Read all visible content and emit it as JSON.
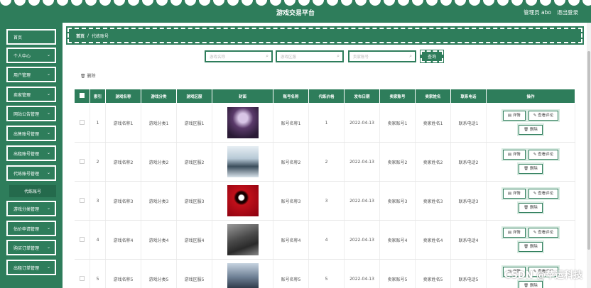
{
  "header": {
    "title": "游戏交易平台",
    "admin_label": "管理员 abo",
    "logout_label": "退出登录"
  },
  "sidebar": {
    "items": [
      {
        "label": "首页",
        "expandable": false
      },
      {
        "label": "个人中心",
        "expandable": true
      },
      {
        "label": "用户管理",
        "expandable": true
      },
      {
        "label": "卖家管理",
        "expandable": true
      },
      {
        "label": "网站公告管理",
        "expandable": true
      },
      {
        "label": "出售账号管理",
        "expandable": true
      },
      {
        "label": "出租账号管理",
        "expandable": true
      },
      {
        "label": "代练账号管理",
        "expandable": true
      },
      {
        "label": "游戏分类管理",
        "expandable": true
      },
      {
        "label": "估价申请管理",
        "expandable": true
      },
      {
        "label": "购买订单管理",
        "expandable": true
      },
      {
        "label": "出租订单管理",
        "expandable": true
      }
    ],
    "sub_item": "代练账号"
  },
  "breadcrumb": {
    "home": "首页",
    "separator": "/",
    "current": "代练账号"
  },
  "search": {
    "game_name_placeholder": "游戏名称",
    "game_region_placeholder": "游戏区服",
    "seller_account_placeholder": "卖家账号",
    "button_label": "查询"
  },
  "toolbar": {
    "delete_label": "删除"
  },
  "table": {
    "headers": [
      "索引",
      "游戏名称",
      "游戏分类",
      "游戏区服",
      "封面",
      "账号名称",
      "代练价格",
      "发布日期",
      "卖家账号",
      "卖家姓名",
      "联系电话",
      "操作"
    ],
    "rows": [
      {
        "index": "1",
        "game_name": "游戏名称1",
        "category": "游戏分类1",
        "region": "游戏区服1",
        "account_name": "账号名称1",
        "price": "1",
        "date": "2022-04-13",
        "seller_account": "卖家账号1",
        "seller_name": "卖家姓名1",
        "phone": "联系电话1"
      },
      {
        "index": "2",
        "game_name": "游戏名称2",
        "category": "游戏分类2",
        "region": "游戏区服2",
        "account_name": "账号名称2",
        "price": "2",
        "date": "2022-04-13",
        "seller_account": "卖家账号2",
        "seller_name": "卖家姓名2",
        "phone": "联系电话2"
      },
      {
        "index": "3",
        "game_name": "游戏名称3",
        "category": "游戏分类3",
        "region": "游戏区服3",
        "account_name": "账号名称3",
        "price": "3",
        "date": "2022-04-13",
        "seller_account": "卖家账号3",
        "seller_name": "卖家姓名3",
        "phone": "联系电话3"
      },
      {
        "index": "4",
        "game_name": "游戏名称4",
        "category": "游戏分类4",
        "region": "游戏区服4",
        "account_name": "账号名称4",
        "price": "4",
        "date": "2022-04-13",
        "seller_account": "卖家账号4",
        "seller_name": "卖家姓名4",
        "phone": "联系电话4"
      },
      {
        "index": "5",
        "game_name": "游戏名称5",
        "category": "游戏分类5",
        "region": "游戏区服5",
        "account_name": "账号名称5",
        "price": "5",
        "date": "2022-04-13",
        "seller_account": "卖家账号5",
        "seller_name": "卖家姓名5",
        "phone": "联系电话5"
      }
    ],
    "actions": {
      "detail": "详情",
      "review": "查看评论",
      "delete": "删除"
    }
  },
  "watermark": "CSDN @苹运科技",
  "colors": {
    "primary": "#2e7d5b",
    "text": "#555555"
  }
}
